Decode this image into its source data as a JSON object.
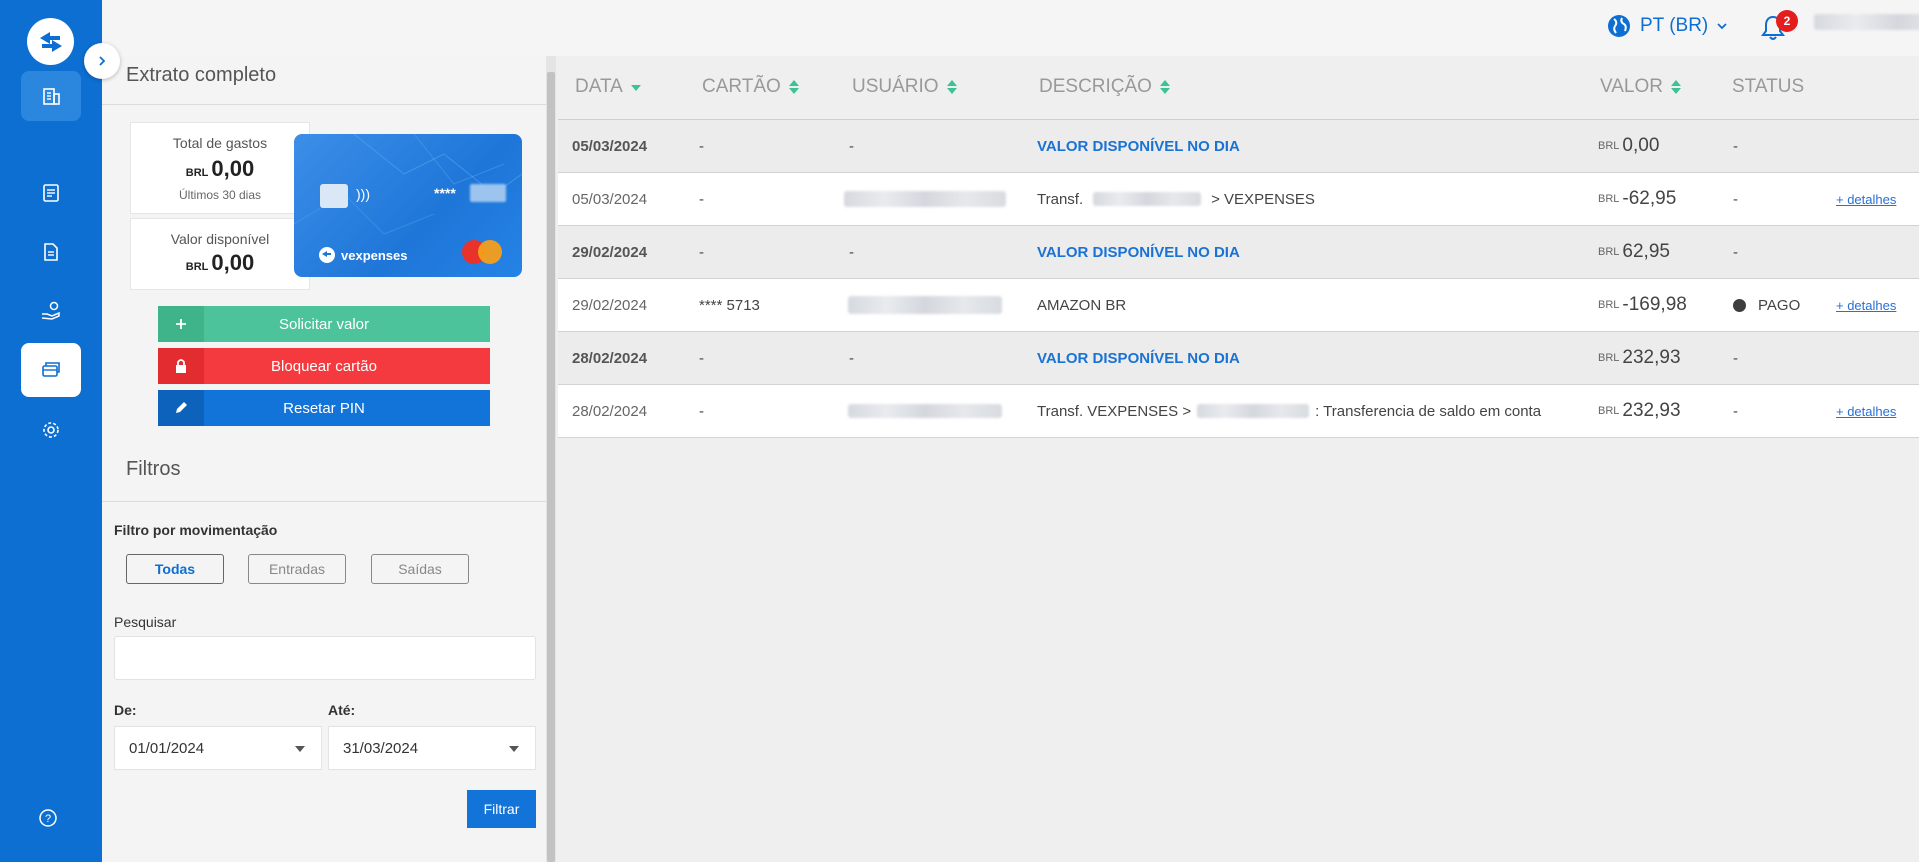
{
  "nav": {
    "items": [
      "building-icon",
      "receipt-icon",
      "document-icon",
      "hand-money-icon",
      "cards-icon",
      "gear-icon"
    ],
    "active": "cards-icon"
  },
  "topbar": {
    "language": "PT (BR)",
    "notifications_count": "2"
  },
  "panel": {
    "title": "Extrato completo",
    "total_gastos": {
      "label": "Total de gastos",
      "currency": "BRL",
      "value": "0,00",
      "period": "Últimos 30 dias"
    },
    "valor_disponivel": {
      "label": "Valor disponível",
      "currency": "BRL",
      "value": "0,00"
    },
    "card": {
      "masked": "****",
      "brand": "vexpenses"
    },
    "actions": {
      "request": "Solicitar valor",
      "block": "Bloquear cartão",
      "reset_pin": "Resetar PIN"
    },
    "filters": {
      "title": "Filtros",
      "movement_label": "Filtro por movimentação",
      "options": [
        "Todas",
        "Entradas",
        "Saídas"
      ],
      "selected": "Todas",
      "search_label": "Pesquisar",
      "search_value": "",
      "from_label": "De:",
      "from_value": "01/01/2024",
      "to_label": "Até:",
      "to_value": "31/03/2024",
      "submit": "Filtrar"
    }
  },
  "table": {
    "headers": {
      "date": "DATA",
      "card": "CARTÃO",
      "user": "USUÁRIO",
      "desc": "DESCRIÇÃO",
      "value": "VALOR",
      "status": "STATUS"
    },
    "rows": [
      {
        "type": "group",
        "date": "05/03/2024",
        "card": "-",
        "user": "-",
        "desc": "VALOR DISPONÍVEL NO DIA",
        "currency": "BRL",
        "value": "0,00",
        "status": "-",
        "link": ""
      },
      {
        "type": "tx",
        "date": "05/03/2024",
        "card": "-",
        "user": "",
        "desc_pre": "Transf.",
        "desc_post": "> VEXPENSES",
        "currency": "BRL",
        "value": "-62,95",
        "status": "-",
        "link": "+ detalhes"
      },
      {
        "type": "group",
        "date": "29/02/2024",
        "card": "-",
        "user": "-",
        "desc": "VALOR DISPONÍVEL NO DIA",
        "currency": "BRL",
        "value": "62,95",
        "status": "-",
        "link": ""
      },
      {
        "type": "tx",
        "date": "29/02/2024",
        "card": "**** 5713",
        "user": "",
        "desc": "AMAZON BR",
        "currency": "BRL",
        "value": "-169,98",
        "status": "PAGO",
        "link": "+ detalhes"
      },
      {
        "type": "group",
        "date": "28/02/2024",
        "card": "-",
        "user": "-",
        "desc": "VALOR DISPONÍVEL NO DIA",
        "currency": "BRL",
        "value": "232,93",
        "status": "-",
        "link": ""
      },
      {
        "type": "tx",
        "date": "28/02/2024",
        "card": "-",
        "user": "",
        "desc_pre": "Transf. VEXPENSES >",
        "desc_post": ": Transferencia de saldo em conta",
        "currency": "BRL",
        "value": "232,93",
        "status": "-",
        "link": "+ detalhes"
      }
    ]
  },
  "colors": {
    "brand_blue": "#0d6fd1",
    "green": "#4cc39a",
    "red": "#f43a3e",
    "link_blue": "#1a73d4"
  }
}
